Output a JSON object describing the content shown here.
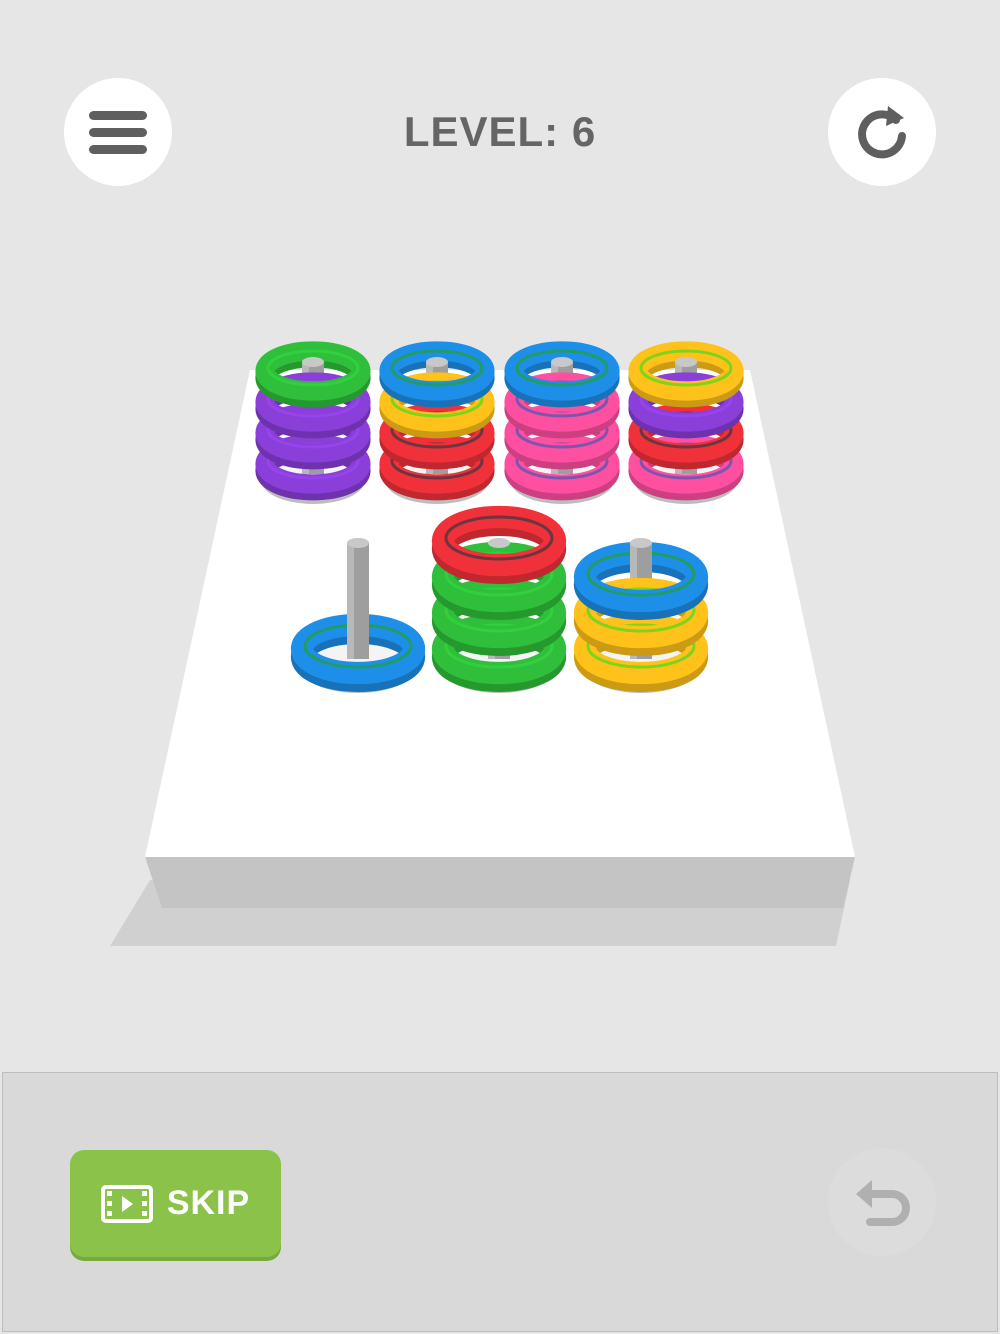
{
  "header": {
    "level_label": "LEVEL: 6",
    "menu_icon": "hamburger-menu-icon",
    "restart_icon": "restart-icon"
  },
  "pegs": [
    {
      "rings": [
        "purple",
        "purple",
        "purple",
        "green"
      ]
    },
    {
      "rings": [
        "red",
        "red",
        "yellow",
        "blue"
      ]
    },
    {
      "rings": [
        "pink",
        "pink",
        "pink",
        "blue"
      ]
    },
    {
      "rings": [
        "pink",
        "red",
        "purple",
        "yellow"
      ]
    },
    {
      "rings": [
        "blue"
      ]
    },
    {
      "rings": [
        "green",
        "green",
        "green",
        "red"
      ]
    },
    {
      "rings": [
        "yellow",
        "yellow",
        "blue"
      ]
    }
  ],
  "colors": {
    "purple": "#8a3fd9",
    "green": "#2fbf3a",
    "red": "#f0313a",
    "yellow": "#ffc21a",
    "blue": "#1e8fe8",
    "pink": "#ff4fa0",
    "peg": "#9e9e9e",
    "board_top": "#ffffff",
    "board_side": "#c4c4c4"
  },
  "footer": {
    "skip_label": "SKIP",
    "skip_icon": "video-ad-icon",
    "undo_icon": "undo-icon",
    "skip_color": "#8bc34a"
  }
}
